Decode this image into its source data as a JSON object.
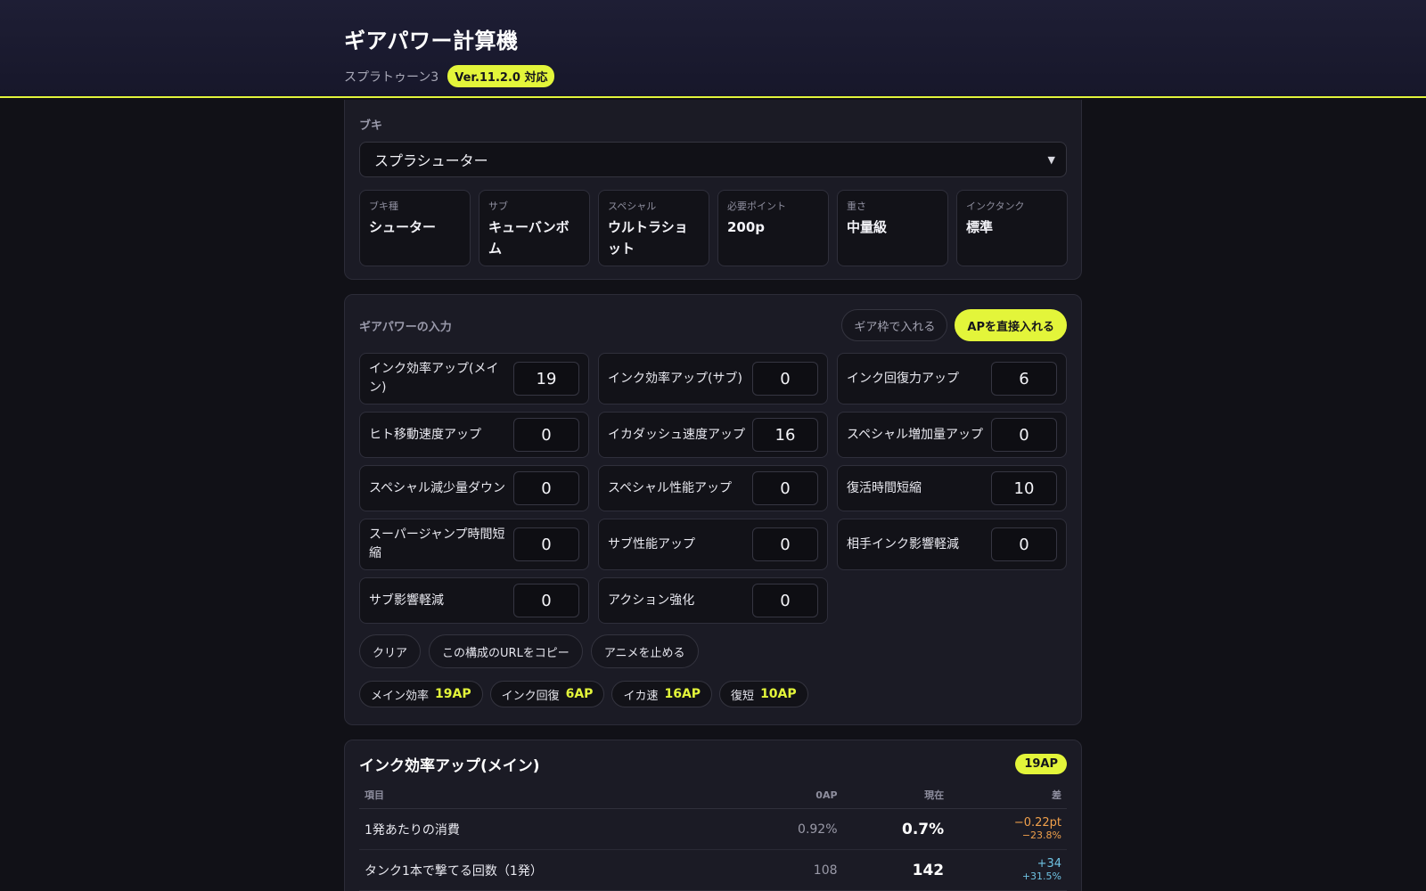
{
  "header": {
    "title": "ギアパワー計算機",
    "game": "スプラトゥーン3",
    "version_badge": "Ver.11.2.0 対応"
  },
  "weapon": {
    "label": "ブキ",
    "selected": "スプラシューター",
    "stats": [
      {
        "label": "ブキ種",
        "value": "シューター"
      },
      {
        "label": "サブ",
        "value": "キューバンボム"
      },
      {
        "label": "スペシャル",
        "value": "ウルトラショット"
      },
      {
        "label": "必要ポイント",
        "value": "200p"
      },
      {
        "label": "重さ",
        "value": "中量級"
      },
      {
        "label": "インクタンク",
        "value": "標準"
      }
    ]
  },
  "gear_input": {
    "label": "ギアパワーの入力",
    "mode_slot": "ギア枠で入れる",
    "mode_direct": "APを直接入れる",
    "abilities": [
      {
        "label": "インク効率アップ(メイン)",
        "value": "19"
      },
      {
        "label": "インク効率アップ(サブ)",
        "value": "0"
      },
      {
        "label": "インク回復力アップ",
        "value": "6"
      },
      {
        "label": "ヒト移動速度アップ",
        "value": "0"
      },
      {
        "label": "イカダッシュ速度アップ",
        "value": "16"
      },
      {
        "label": "スペシャル増加量アップ",
        "value": "0"
      },
      {
        "label": "スペシャル減少量ダウン",
        "value": "0"
      },
      {
        "label": "スペシャル性能アップ",
        "value": "0"
      },
      {
        "label": "復活時間短縮",
        "value": "10"
      },
      {
        "label": "スーパージャンプ時間短縮",
        "value": "0"
      },
      {
        "label": "サブ性能アップ",
        "value": "0"
      },
      {
        "label": "相手インク影響軽減",
        "value": "0"
      },
      {
        "label": "サブ影響軽減",
        "value": "0"
      },
      {
        "label": "アクション強化",
        "value": "0"
      }
    ],
    "actions": {
      "clear": "クリア",
      "copy_url": "この構成のURLをコピー",
      "stop_anim": "アニメを止める"
    },
    "summary": [
      {
        "name": "メイン効率",
        "ap": "19AP"
      },
      {
        "name": "インク回復",
        "ap": "6AP"
      },
      {
        "name": "イカ速",
        "ap": "16AP"
      },
      {
        "name": "復短",
        "ap": "10AP"
      }
    ]
  },
  "result": {
    "title": "インク効率アップ(メイン)",
    "ap_badge": "19AP",
    "columns": {
      "item": "項目",
      "base": "0AP",
      "current": "現在",
      "diff": "差"
    },
    "rows": [
      {
        "item": "1発あたりの消費",
        "base": "0.92%",
        "current": "0.7%",
        "diff": "−0.22pt",
        "diff_pct": "−23.8%",
        "tone": "neg"
      },
      {
        "item": "タンク1本で撃てる回数（1発）",
        "base": "108",
        "current": "142",
        "diff": "+34",
        "diff_pct": "+31.5%",
        "tone": "pos"
      }
    ]
  }
}
